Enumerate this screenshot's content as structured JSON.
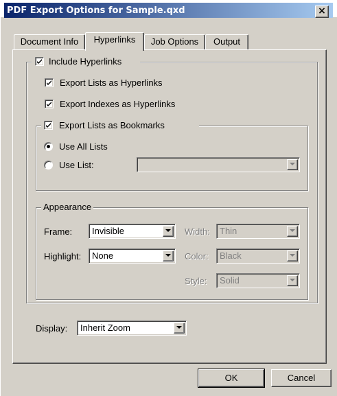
{
  "window": {
    "title": "PDF Export Options for Sample.qxd",
    "close_label": "×"
  },
  "tabs": [
    {
      "label": "Document Info",
      "active": false
    },
    {
      "label": "Hyperlinks",
      "active": true
    },
    {
      "label": "Job Options",
      "active": false
    },
    {
      "label": "Output",
      "active": false
    }
  ],
  "hyperlinks": {
    "include": {
      "label": "Include Hyperlinks",
      "checked": true
    },
    "export_lists": {
      "label": "Export Lists as Hyperlinks",
      "checked": true
    },
    "export_indexes": {
      "label": "Export Indexes as Hyperlinks",
      "checked": true
    },
    "bookmarks": {
      "label": "Export Lists as Bookmarks",
      "checked": true,
      "use_all": {
        "label": "Use All Lists",
        "selected": true
      },
      "use_list": {
        "label": "Use List:",
        "selected": false,
        "value": ""
      }
    }
  },
  "appearance": {
    "group_label": "Appearance",
    "frame": {
      "label": "Frame:",
      "value": "Invisible"
    },
    "highlight": {
      "label": "Highlight:",
      "value": "None"
    },
    "width": {
      "label": "Width:",
      "value": "Thin"
    },
    "color": {
      "label": "Color:",
      "value": "Black"
    },
    "style": {
      "label": "Style:",
      "value": "Solid"
    }
  },
  "display": {
    "label": "Display:",
    "value": "Inherit Zoom"
  },
  "buttons": {
    "ok": "OK",
    "cancel": "Cancel"
  },
  "colors": {
    "titlebar_start": "#0a246a",
    "titlebar_end": "#a6caf0",
    "face": "#d4d0c8"
  }
}
